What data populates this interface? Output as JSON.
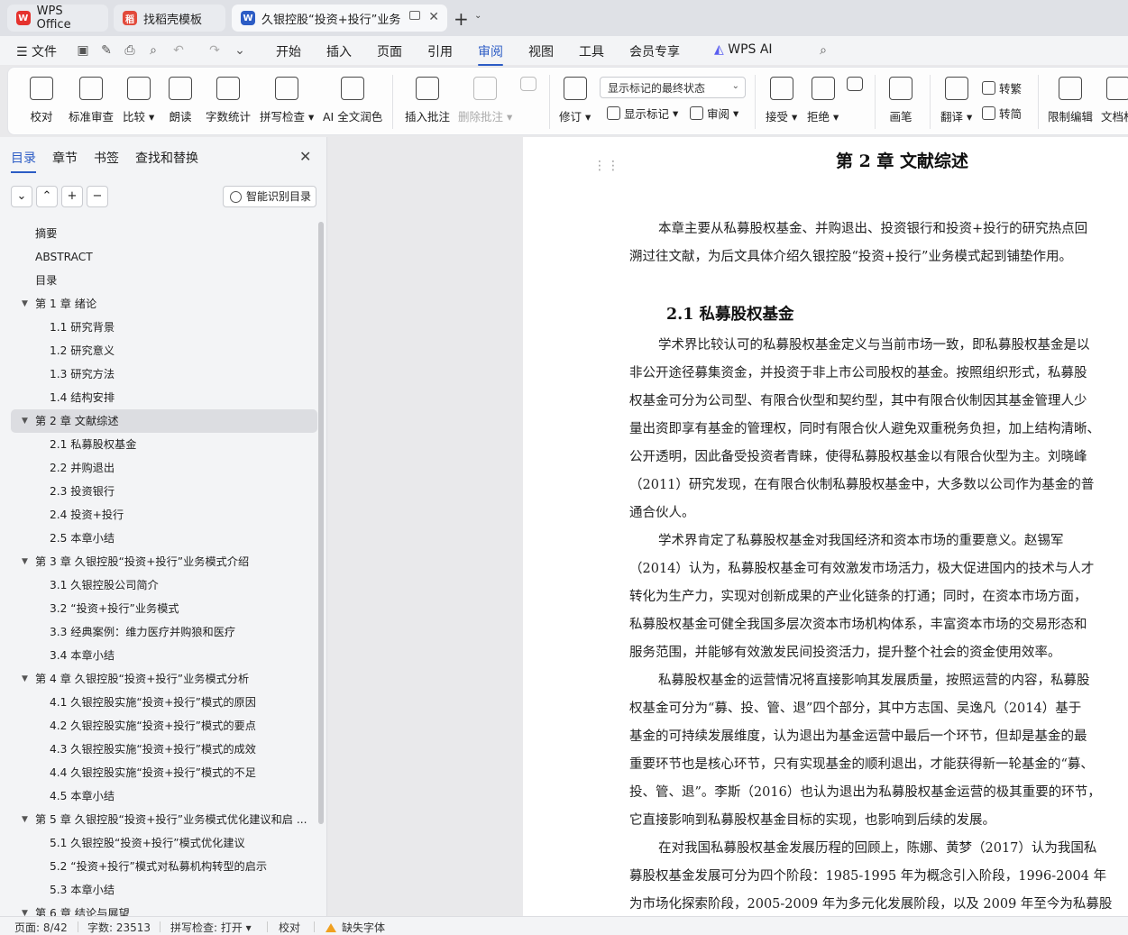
{
  "tabs": [
    {
      "label": "WPS Office",
      "logo": "W",
      "logo_color": "#e5322d"
    },
    {
      "label": "找稻壳模板",
      "logo": "稻",
      "logo_color": "#e24a3b"
    },
    {
      "label": "久银控股“投资+投行”业务",
      "logo": "W",
      "logo_color": "#2c5cc5"
    }
  ],
  "menu": {
    "file": "文件",
    "items": [
      "开始",
      "插入",
      "页面",
      "引用",
      "审阅",
      "视图",
      "工具",
      "会员专享"
    ],
    "active": "审阅",
    "ai": "WPS AI"
  },
  "ribbon": {
    "proofread": "校对",
    "std_review": "标准审查",
    "compare": "比较",
    "read_aloud": "朗读",
    "word_count": "字数统计",
    "spell_check": "拼写检查",
    "ai_polish": "AI 全文润色",
    "insert_comment": "插入批注",
    "delete_comment": "删除批注",
    "track_changes": "修订",
    "markup_mode": "显示标记的最终状态",
    "show_markup": "显示标记",
    "review_pane": "审阅",
    "accept": "接受",
    "reject": "拒绝",
    "pen": "画笔",
    "translate": "翻译",
    "to_traditional": "转繁",
    "to_simplified": "转简",
    "restrict_edit": "限制编辑",
    "doc_auth": "文档权"
  },
  "nav": {
    "tabs": [
      "目录",
      "章节",
      "书签",
      "查找和替换"
    ],
    "smart_toc": "智能识别目录",
    "toc": [
      {
        "label": "摘要",
        "level": 0
      },
      {
        "label": "ABSTRACT",
        "level": 0
      },
      {
        "label": "目录",
        "level": 0
      },
      {
        "label": "第 1 章  绪论",
        "level": 1
      },
      {
        "label": "1.1  研究背景",
        "level": 2
      },
      {
        "label": "1.2  研究意义",
        "level": 2
      },
      {
        "label": "1.3  研究方法",
        "level": 2
      },
      {
        "label": "1.4  结构安排",
        "level": 2
      },
      {
        "label": "第 2 章  文献综述",
        "level": 1,
        "selected": true
      },
      {
        "label": "2.1  私募股权基金",
        "level": 2
      },
      {
        "label": "2.2  并购退出",
        "level": 2
      },
      {
        "label": "2.3  投资银行",
        "level": 2
      },
      {
        "label": "2.4  投资+投行",
        "level": 2
      },
      {
        "label": "2.5  本章小结",
        "level": 2
      },
      {
        "label": "第 3 章  久银控股“投资+投行”业务模式介绍",
        "level": 1
      },
      {
        "label": "3.1  久银控股公司简介",
        "level": 2
      },
      {
        "label": "3.2  “投资+投行”业务模式",
        "level": 2
      },
      {
        "label": "3.3  经典案例：维力医疗并购狼和医疗",
        "level": 2
      },
      {
        "label": "3.4  本章小结",
        "level": 2
      },
      {
        "label": "第 4 章  久银控股“投资+投行”业务模式分析",
        "level": 1
      },
      {
        "label": "4.1  久银控股实施“投资+投行”模式的原因",
        "level": 2
      },
      {
        "label": "4.2  久银控股实施“投资+投行”模式的要点",
        "level": 2
      },
      {
        "label": "4.3  久银控股实施“投资+投行”模式的成效",
        "level": 2
      },
      {
        "label": "4.4  久银控股实施“投资+投行”模式的不足",
        "level": 2
      },
      {
        "label": "4.5  本章小结",
        "level": 2
      },
      {
        "label": "第 5 章  久银控股“投资+投行”业务模式优化建议和启 ...",
        "level": 1
      },
      {
        "label": "5.1  久银控股“投资+投行”模式优化建议",
        "level": 2
      },
      {
        "label": "5.2  “投资+投行”模式对私募机构转型的启示",
        "level": 2
      },
      {
        "label": "5.3  本章小结",
        "level": 2
      },
      {
        "label": "第 6 章  结论与展望",
        "level": 1
      }
    ]
  },
  "doc": {
    "chapter_title": "第 2 章  文献综述",
    "section_title": "2.1  私募股权基金",
    "intro_lines": [
      "本章主要从私募股权基金、并购退出、投资银行和投资+投行的研究热点回",
      "溯过往文献，为后文具体介绍久银控股“投资+投行”业务模式起到铺垫作用。"
    ],
    "body_lines": [
      "学术界比较认可的私募股权基金定义与当前市场一致，即私募股权基金是以",
      "非公开途径募集资金，并投资于非上市公司股权的基金。按照组织形式，私募股",
      "权基金可分为公司型、有限合伙型和契约型，其中有限合伙制因其基金管理人少",
      "量出资即享有基金的管理权，同时有限合伙人避免双重税务负担，加上结构清晰、",
      "公开透明，因此备受投资者青睐，使得私募股权基金以有限合伙型为主。刘晓峰",
      "（2011）研究发现，在有限合伙制私募股权基金中，大多数以公司作为基金的普",
      "通合伙人。",
      "学术界肯定了私募股权基金对我国经济和资本市场的重要意义。赵锡军",
      "（2014）认为，私募股权基金可有效激发市场活力，极大促进国内的技术与人才",
      "转化为生产力，实现对创新成果的产业化链条的打通；同时，在资本市场方面，",
      "私募股权基金可健全我国多层次资本市场机构体系，丰富资本市场的交易形态和",
      "服务范围，并能够有效激发民间投资活力，提升整个社会的资金使用效率。",
      "私募股权基金的运营情况将直接影响其发展质量，按照运营的内容，私募股",
      "权基金可分为“募、投、管、退”四个部分，其中方志国、吴逸凡（2014）基于",
      "基金的可持续发展维度，认为退出为基金运营中最后一个环节，但却是基金的最",
      "重要环节也是核心环节，只有实现基金的顺利退出，才能获得新一轮基金的“募、",
      "投、管、退”。李斯（2016）也认为退出为私募股权基金运营的极其重要的环节，",
      "它直接影响到私募股权基金目标的实现，也影响到后续的发展。",
      "在对我国私募股权基金发展历程的回顾上，陈娜、黄梦（2017）认为我国私",
      "募股权基金发展可分为四个阶段：1985-1995 年为概念引入阶段，1996-2004 年",
      "为市场化探索阶段，2005-2009 年为多元化发展阶段，以及 2009 年至今为私募股"
    ]
  },
  "status": {
    "page": "页面: 8/42",
    "words": "字数: 23513",
    "spell": "拼写检查: 打开",
    "proof": "校对",
    "missing_font": "缺失字体"
  },
  "colors": {
    "accent": "#2c5cc5",
    "warning": "#f0a020"
  }
}
